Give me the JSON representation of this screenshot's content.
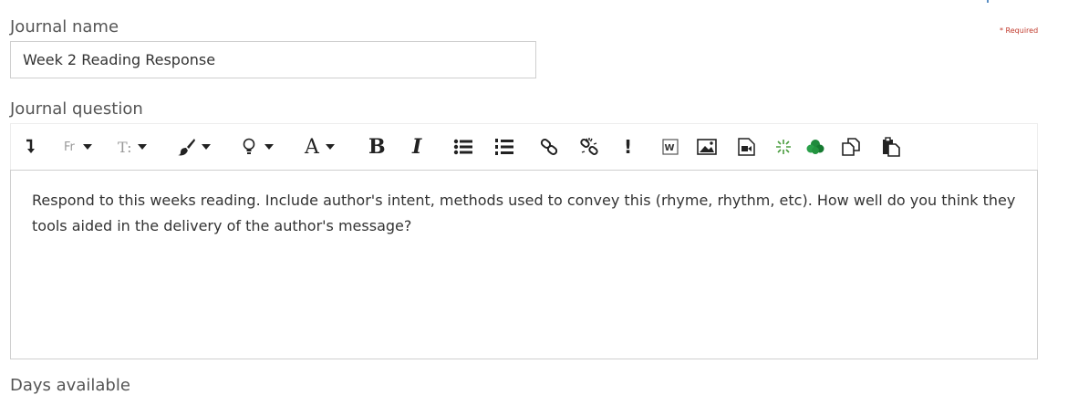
{
  "form": {
    "name_label": "Journal name",
    "required_text": "* Required",
    "name_value": "Week 2 Reading Response",
    "question_label": "Journal question",
    "days_label": "Days available"
  },
  "editor": {
    "toolbar": {
      "font_family_text": "Fr",
      "font_size_text": "T:",
      "text_color_text": "A",
      "bold_text": "B",
      "italic_text": "I",
      "important_text": "!",
      "icons": [
        "insert-below-icon",
        "paint-brush-icon",
        "lightbulb-icon",
        "bulleted-list-icon",
        "numbered-list-icon",
        "link-icon",
        "unlink-icon",
        "word-import-icon",
        "image-icon",
        "video-icon",
        "sparkle-icon",
        "cloud-icon",
        "copy-icon",
        "paste-icon"
      ]
    },
    "content": "Respond to this weeks reading. Include author's intent, methods used to convey this (rhyme, rhythm, etc). How well do you think they tools aided in the delivery of the author's message?"
  },
  "colors": {
    "required": "#c0392b",
    "border": "#cfcfcf",
    "label": "#555555"
  }
}
